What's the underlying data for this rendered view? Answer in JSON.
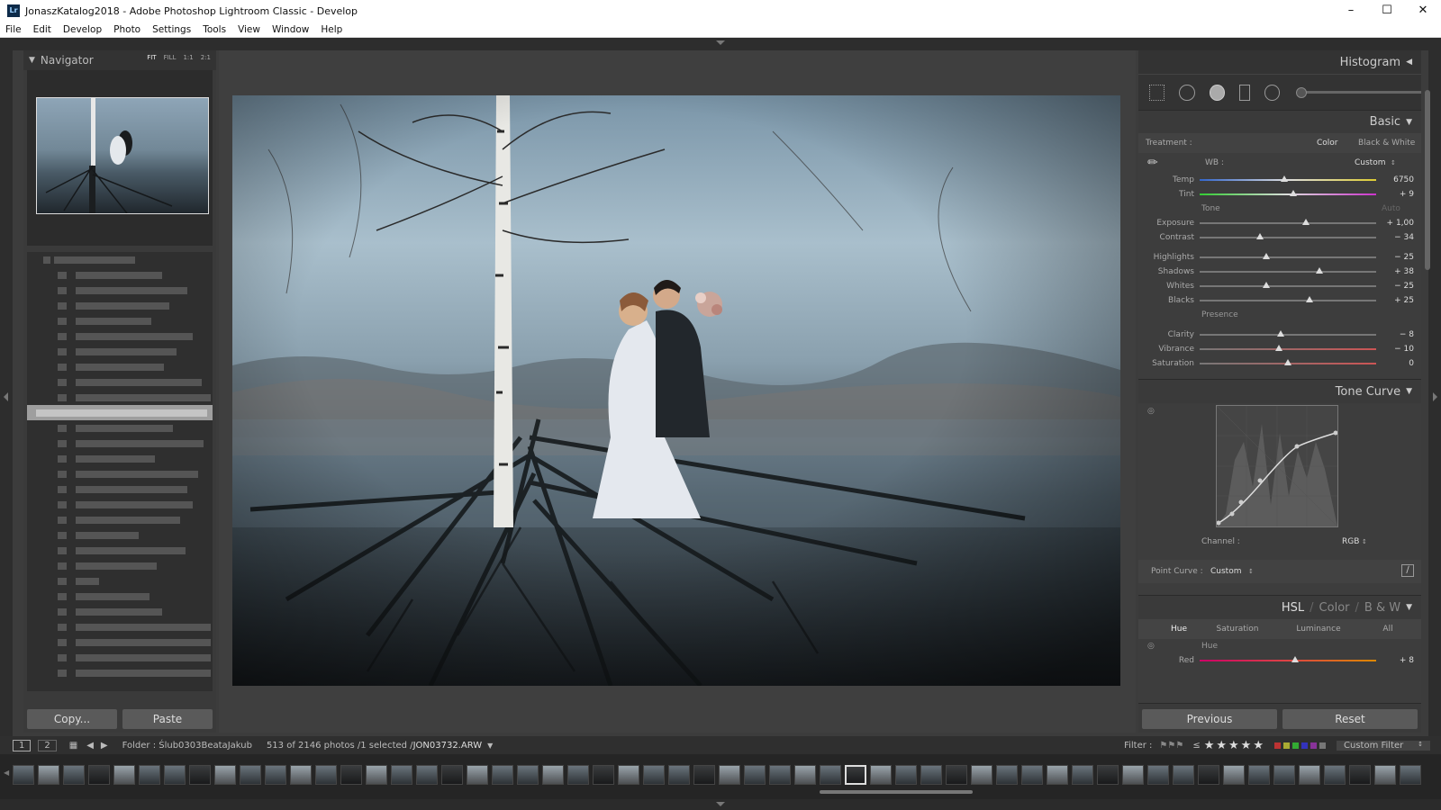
{
  "window": {
    "app_icon": "Lr",
    "title": "JonaszKatalog2018 - Adobe Photoshop Lightroom Classic - Develop"
  },
  "menu": [
    "File",
    "Edit",
    "Develop",
    "Photo",
    "Settings",
    "Tools",
    "View",
    "Window",
    "Help"
  ],
  "navigator": {
    "title": "Navigator",
    "zoom_options": [
      "FIT",
      "FILL",
      "1:1",
      "2:1"
    ]
  },
  "left_buttons": {
    "copy": "Copy...",
    "paste": "Paste"
  },
  "right_panel": {
    "histogram": "Histogram",
    "basic": {
      "title": "Basic",
      "treatment_label": "Treatment :",
      "treatment_color": "Color",
      "treatment_bw": "Black & White",
      "wb_label": "WB :",
      "wb_value": "Custom",
      "tone_label": "Tone",
      "tone_auto": "Auto",
      "presence_label": "Presence",
      "sliders": [
        {
          "label": "Temp",
          "value": "6750",
          "pos": 0.48
        },
        {
          "label": "Tint",
          "value": "+ 9",
          "pos": 0.53
        },
        {
          "label": "Exposure",
          "value": "+ 1,00",
          "pos": 0.6
        },
        {
          "label": "Contrast",
          "value": "− 34",
          "pos": 0.34
        },
        {
          "label": "Highlights",
          "value": "− 25",
          "pos": 0.38
        },
        {
          "label": "Shadows",
          "value": "+ 38",
          "pos": 0.68
        },
        {
          "label": "Whites",
          "value": "− 25",
          "pos": 0.38
        },
        {
          "label": "Blacks",
          "value": "+ 25",
          "pos": 0.62
        },
        {
          "label": "Clarity",
          "value": "− 8",
          "pos": 0.46
        },
        {
          "label": "Vibrance",
          "value": "− 10",
          "pos": 0.45
        },
        {
          "label": "Saturation",
          "value": "0",
          "pos": 0.5
        }
      ]
    },
    "tone_curve": {
      "title": "Tone Curve",
      "channel_label": "Channel :",
      "channel_value": "RGB",
      "point_curve_label": "Point Curve :",
      "point_curve_value": "Custom"
    },
    "hsl": {
      "tabs": [
        "HSL",
        "Color",
        "B & W"
      ],
      "subtabs": [
        "Hue",
        "Saturation",
        "Luminance",
        "All"
      ],
      "group_label": "Hue",
      "red_label": "Red",
      "red_value": "+ 8",
      "red_pos": 0.54
    },
    "buttons": {
      "previous": "Previous",
      "reset": "Reset"
    }
  },
  "filmstrip_bar": {
    "screen1": "1",
    "screen2": "2",
    "folder": "Folder : Ślub0303BeataJakub",
    "count": "513 of 2146 photos /1 selected /",
    "filename": "JON03732.ARW",
    "filter_label": "Filter :",
    "rating_op": "≤",
    "stars": "★★★★★",
    "custom_filter": "Custom Filter"
  },
  "colors": {
    "bg": "#3c3c3c",
    "panel": "#3a3a3a",
    "text": "#cccccc"
  }
}
